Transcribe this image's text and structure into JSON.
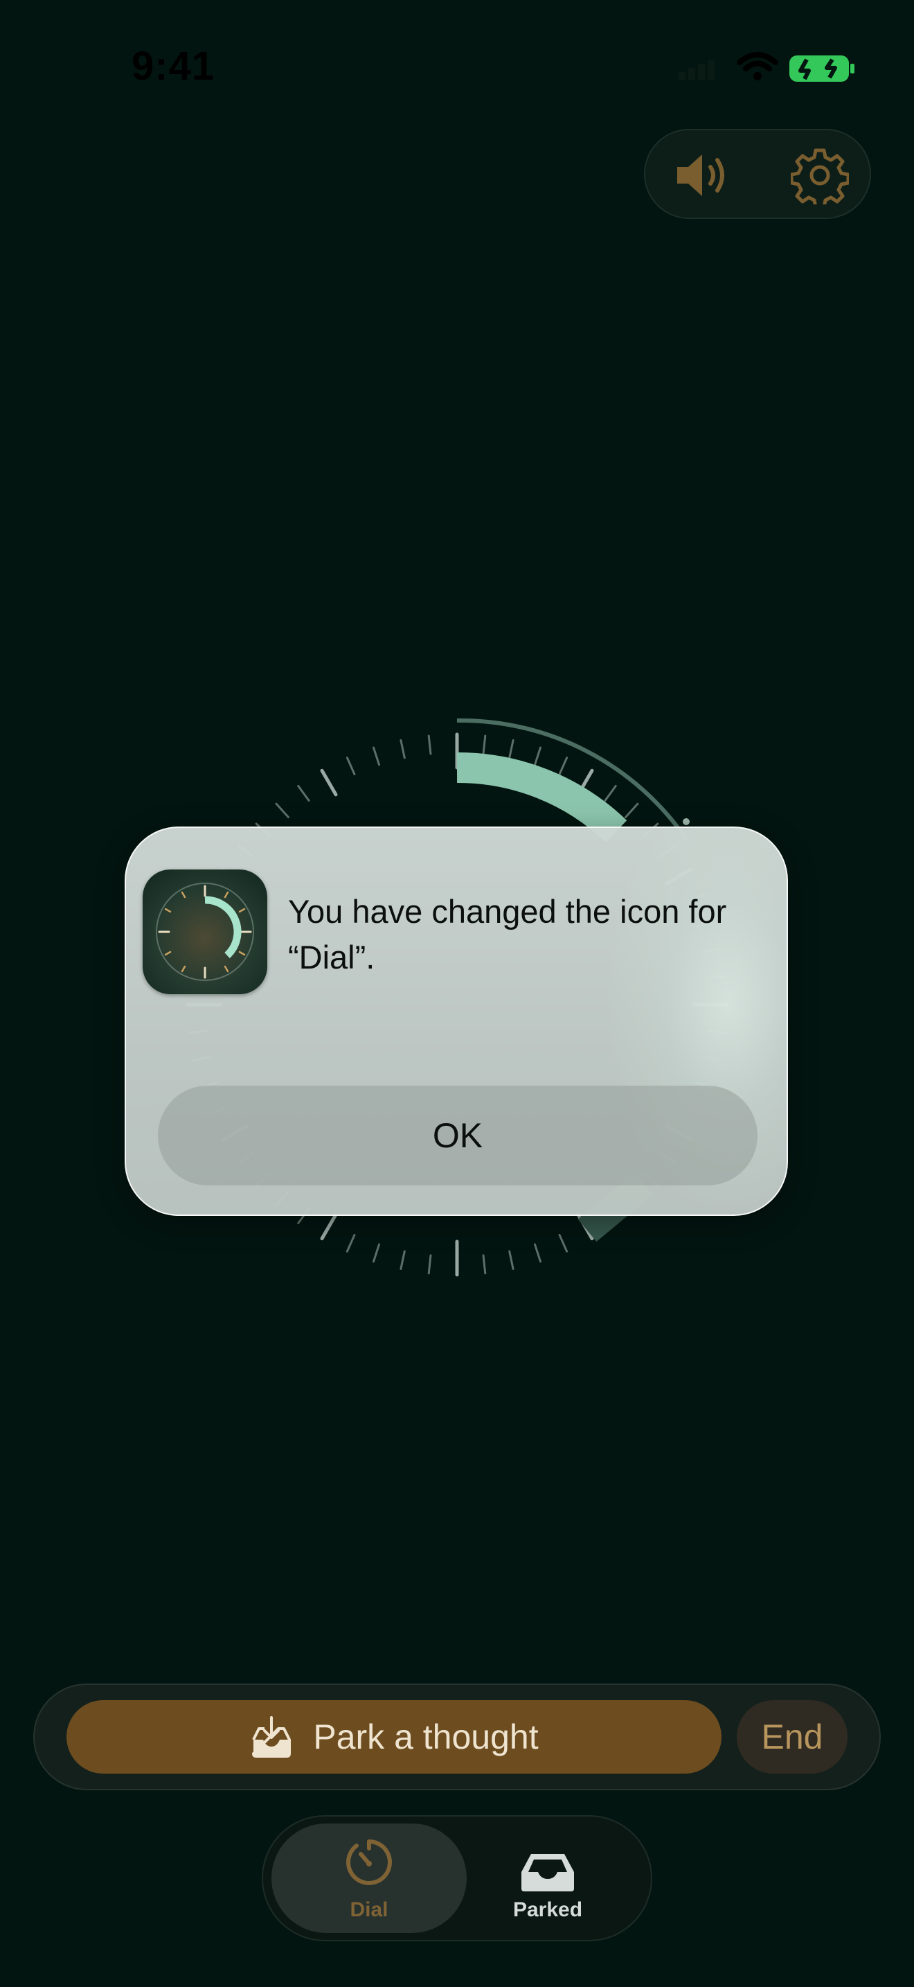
{
  "status_bar": {
    "time": "9:41"
  },
  "top_controls": {
    "sound_icon": "speaker-wave-icon",
    "settings_icon": "gear-icon"
  },
  "alert": {
    "message": "You have changed the icon for “Dial”.",
    "ok_label": "OK",
    "app_icon": "dial-app-icon"
  },
  "action_bar": {
    "park_label": "Park a thought",
    "park_icon": "tray-download-icon",
    "end_label": "End"
  },
  "tab_bar": {
    "tabs": [
      {
        "label": "Dial",
        "icon": "timer-dial-icon",
        "selected": true
      },
      {
        "label": "Parked",
        "icon": "inbox-tray-icon",
        "selected": false
      }
    ]
  },
  "colors": {
    "background": "#031510",
    "accent_gold": "#6d4d1f",
    "dial_mint": "#9fd3bd"
  }
}
